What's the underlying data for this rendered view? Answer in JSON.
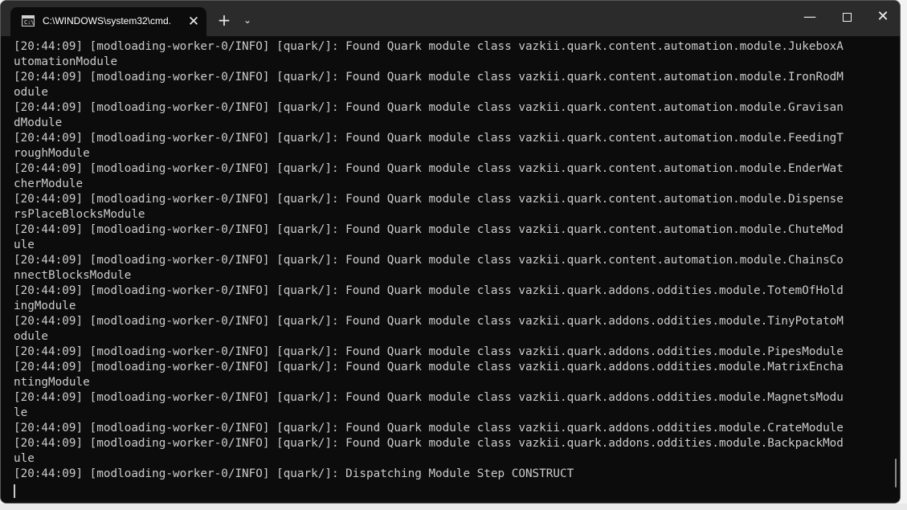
{
  "window": {
    "tab_title": "C:\\WINDOWS\\system32\\cmd.",
    "tab_icon": "cmd-icon",
    "tab_icon_text": "C:\\",
    "close_tab_glyph": "✕",
    "new_tab_glyph": "+",
    "tab_menu_glyph": "⌄",
    "minimize_glyph": "—",
    "close_glyph": "✕"
  },
  "console": {
    "lines": [
      "[20:44:09] [modloading-worker-0/INFO] [quark/]: Found Quark module class vazkii.quark.content.automation.module.JukeboxA",
      "utomationModule",
      "[20:44:09] [modloading-worker-0/INFO] [quark/]: Found Quark module class vazkii.quark.content.automation.module.IronRodM",
      "odule",
      "[20:44:09] [modloading-worker-0/INFO] [quark/]: Found Quark module class vazkii.quark.content.automation.module.Gravisan",
      "dModule",
      "[20:44:09] [modloading-worker-0/INFO] [quark/]: Found Quark module class vazkii.quark.content.automation.module.FeedingT",
      "roughModule",
      "[20:44:09] [modloading-worker-0/INFO] [quark/]: Found Quark module class vazkii.quark.content.automation.module.EnderWat",
      "cherModule",
      "[20:44:09] [modloading-worker-0/INFO] [quark/]: Found Quark module class vazkii.quark.content.automation.module.Dispense",
      "rsPlaceBlocksModule",
      "[20:44:09] [modloading-worker-0/INFO] [quark/]: Found Quark module class vazkii.quark.content.automation.module.ChuteMod",
      "ule",
      "[20:44:09] [modloading-worker-0/INFO] [quark/]: Found Quark module class vazkii.quark.content.automation.module.ChainsCo",
      "nnectBlocksModule",
      "[20:44:09] [modloading-worker-0/INFO] [quark/]: Found Quark module class vazkii.quark.addons.oddities.module.TotemOfHold",
      "ingModule",
      "[20:44:09] [modloading-worker-0/INFO] [quark/]: Found Quark module class vazkii.quark.addons.oddities.module.TinyPotatoM",
      "odule",
      "[20:44:09] [modloading-worker-0/INFO] [quark/]: Found Quark module class vazkii.quark.addons.oddities.module.PipesModule",
      "[20:44:09] [modloading-worker-0/INFO] [quark/]: Found Quark module class vazkii.quark.addons.oddities.module.MatrixEncha",
      "ntingModule",
      "[20:44:09] [modloading-worker-0/INFO] [quark/]: Found Quark module class vazkii.quark.addons.oddities.module.MagnetsModu",
      "le",
      "[20:44:09] [modloading-worker-0/INFO] [quark/]: Found Quark module class vazkii.quark.addons.oddities.module.CrateModule",
      "[20:44:09] [modloading-worker-0/INFO] [quark/]: Found Quark module class vazkii.quark.addons.oddities.module.BackpackMod",
      "ule",
      "[20:44:09] [modloading-worker-0/INFO] [quark/]: Dispatching Module Step CONSTRUCT"
    ]
  },
  "colors": {
    "console_bg": "#0c0c0c",
    "console_fg": "#cccccc",
    "titlebar_bg": "#2b2b2b"
  }
}
